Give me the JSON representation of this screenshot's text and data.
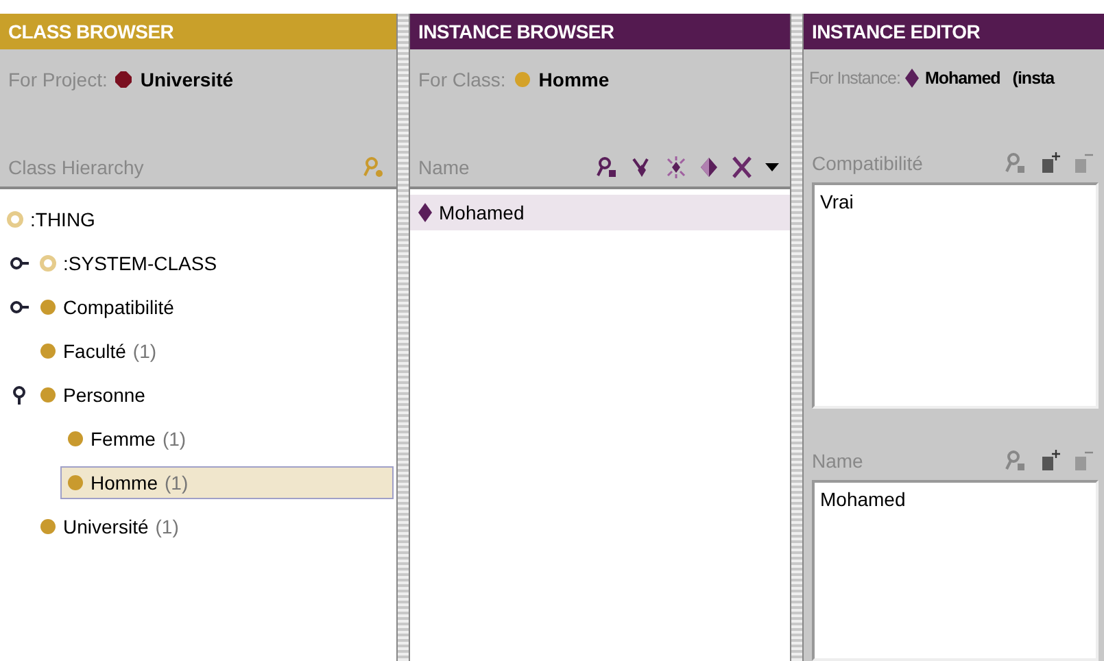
{
  "class_browser": {
    "title": "CLASS BROWSER",
    "project_label": "For Project:",
    "project_name": "Université",
    "hierarchy_label": "Class Hierarchy",
    "tree": [
      {
        "name": ":THING",
        "color": "#e6cc8c",
        "hollow": true,
        "selected": false,
        "children": [
          {
            "name": ":SYSTEM-CLASS",
            "color": "#e6cc8c",
            "hollow": true,
            "expanded": false,
            "selected": false
          },
          {
            "name": "Compatibilité",
            "color": "#c99a2e",
            "hollow": false,
            "expanded": false,
            "selected": false
          },
          {
            "name": "Faculté",
            "count": "(1)",
            "color": "#c99a2e",
            "hollow": false,
            "selected": false
          },
          {
            "name": "Personne",
            "color": "#c99a2e",
            "hollow": false,
            "expanded": true,
            "selected": false,
            "children": [
              {
                "name": "Femme",
                "count": "(1)",
                "color": "#c99a2e",
                "hollow": false,
                "selected": false
              },
              {
                "name": "Homme",
                "count": "(1)",
                "color": "#c99a2e",
                "hollow": false,
                "selected": true
              }
            ]
          },
          {
            "name": "Université",
            "count": "(1)",
            "color": "#c99a2e",
            "hollow": false,
            "selected": false
          }
        ]
      }
    ]
  },
  "instance_browser": {
    "title": "INSTANCE BROWSER",
    "class_label": "For Class:",
    "class_name": "Homme",
    "list_label": "Name",
    "instances": [
      {
        "name": "Mohamed",
        "selected": true
      }
    ]
  },
  "instance_editor": {
    "title": "INSTANCE EDITOR",
    "instance_label": "For Instance:",
    "instance_name": "Mohamed",
    "instance_note": "(insta",
    "slots": [
      {
        "label": "Compatibilité",
        "value": "Vrai"
      },
      {
        "label": "Name",
        "value": "Mohamed"
      }
    ]
  }
}
